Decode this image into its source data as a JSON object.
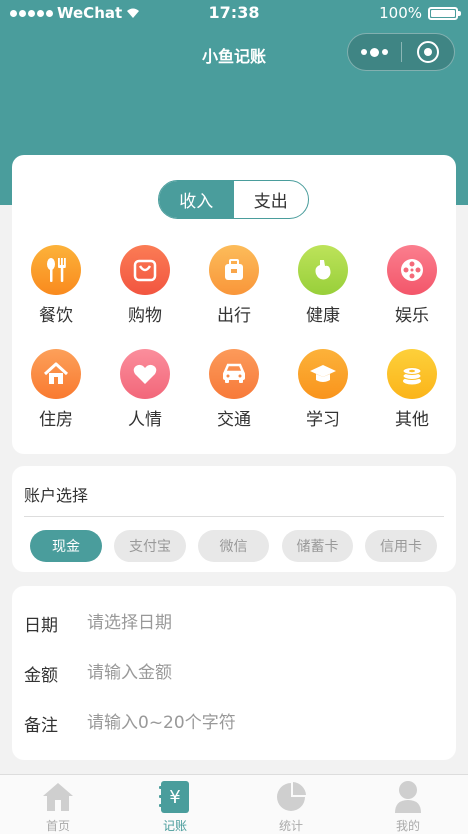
{
  "status": {
    "carrier": "WeChat",
    "time": "17:38",
    "battery": "100%"
  },
  "nav": {
    "title": "小鱼记账"
  },
  "type_toggle": {
    "income": "收入",
    "expense": "支出",
    "selected": "收入"
  },
  "categories": [
    {
      "label": "餐饮",
      "icon": "fork-knife-icon",
      "color": "#fb9a2b"
    },
    {
      "label": "购物",
      "icon": "shopping-bag-icon",
      "color": "#f96a4a"
    },
    {
      "label": "出行",
      "icon": "suitcase-icon",
      "color": "#fba74a"
    },
    {
      "label": "健康",
      "icon": "stomach-icon",
      "color": "#a8d94a"
    },
    {
      "label": "娱乐",
      "icon": "film-reel-icon",
      "color": "#f66a7a"
    },
    {
      "label": "住房",
      "icon": "house-icon",
      "color": "#fb8a3a"
    },
    {
      "label": "人情",
      "icon": "heart-icon",
      "color": "#f77a8a"
    },
    {
      "label": "交通",
      "icon": "car-icon",
      "color": "#fb8a45"
    },
    {
      "label": "学习",
      "icon": "graduation-cap-icon",
      "color": "#fba22a"
    },
    {
      "label": "其他",
      "icon": "coins-icon",
      "color": "#fcc42a"
    }
  ],
  "account": {
    "title": "账户选择",
    "options": [
      "现金",
      "支付宝",
      "微信",
      "储蓄卡",
      "信用卡"
    ],
    "selected": "现金"
  },
  "form": {
    "date_label": "日期",
    "date_placeholder": "请选择日期",
    "amount_label": "金额",
    "amount_placeholder": "请输入金额",
    "note_label": "备注",
    "note_placeholder": "请输入0~20个字符"
  },
  "tabbar": [
    {
      "label": "首页",
      "icon": "home-icon"
    },
    {
      "label": "记账",
      "icon": "ledger-icon",
      "active": true
    },
    {
      "label": "统计",
      "icon": "pie-chart-icon"
    },
    {
      "label": "我的",
      "icon": "user-icon"
    }
  ],
  "colors": {
    "primary": "#4a9d9c"
  }
}
